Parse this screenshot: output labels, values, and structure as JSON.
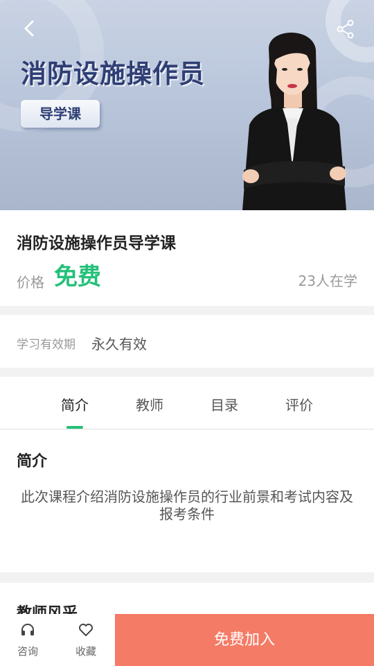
{
  "banner": {
    "title": "消防设施操作员",
    "tag": "导学课"
  },
  "course": {
    "title": "消防设施操作员导学课",
    "price_label": "价格",
    "price_value": "免费",
    "learners": "23人在学"
  },
  "validity": {
    "label": "学习有效期",
    "value": "永久有效"
  },
  "tabs": [
    {
      "label": "简介",
      "active": true
    },
    {
      "label": "教师",
      "active": false
    },
    {
      "label": "目录",
      "active": false
    },
    {
      "label": "评价",
      "active": false
    }
  ],
  "intro": {
    "heading": "简介",
    "text": "此次课程介绍消防设施操作员的行业前景和考试内容及报考条件"
  },
  "teacher": {
    "heading": "教师风采"
  },
  "bottom_bar": {
    "consult_label": "咨询",
    "favorite_label": "收藏",
    "join_label": "免费加入"
  },
  "colors": {
    "accent_green": "#25c07a",
    "join_button": "#f47b66",
    "banner_title": "#2f3e74"
  },
  "icons": [
    "back-arrow-icon",
    "share-icon",
    "headset-icon",
    "heart-icon"
  ]
}
